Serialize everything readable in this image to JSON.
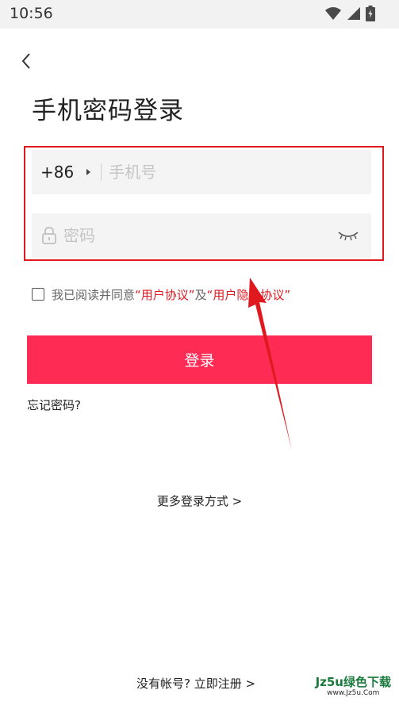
{
  "status_bar": {
    "time": "10:56",
    "icons": [
      "wifi-icon",
      "signal-icon",
      "battery-icon"
    ]
  },
  "header": {
    "back_icon": "chevron-left-icon",
    "title": "手机密码登录"
  },
  "phone": {
    "country_code": "+86",
    "placeholder": "手机号",
    "value": ""
  },
  "password": {
    "placeholder": "密码",
    "value": "",
    "icons": [
      "lock-icon",
      "eye-closed-icon"
    ]
  },
  "agreement": {
    "checked": false,
    "prefix": "我已阅读并同意",
    "user_agreement": "“用户协议”",
    "joiner": "及",
    "privacy_policy": "“用户隐私协议”"
  },
  "login_button": {
    "label": "登录"
  },
  "forgot_password": "忘记密码?",
  "more_login": "更多登录方式 >",
  "register": "没有帐号? 立即注册 >",
  "watermark": {
    "main": "Jz5u绿色下载",
    "sub": "www.Jz5u.Com"
  },
  "colors": {
    "accent": "#fe2c55",
    "link": "#e0191f",
    "annotation": "#e0191f",
    "input_bg": "#f4f4f4"
  }
}
